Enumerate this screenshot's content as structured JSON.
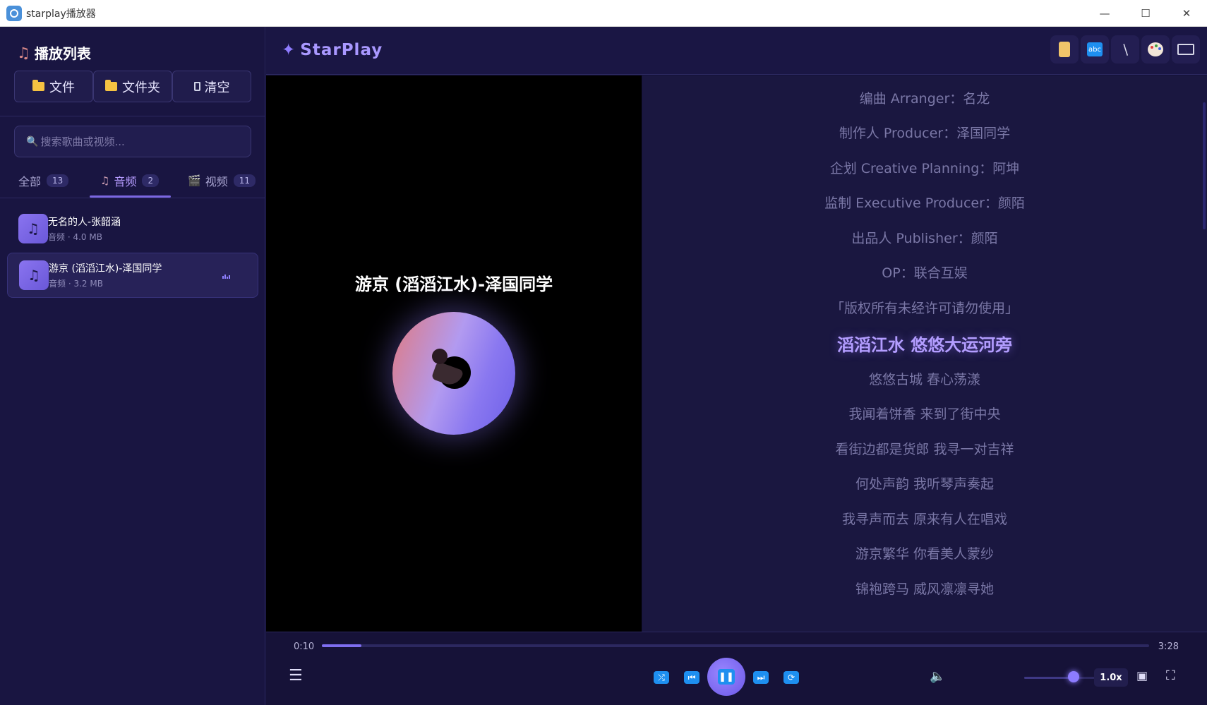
{
  "window": {
    "title": "starplay播放器",
    "minimize": "—",
    "maximize": "☐",
    "close": "✕"
  },
  "sidebar": {
    "heading": "播放列表",
    "buttons": {
      "file": "文件",
      "folder": "文件夹",
      "clear": "清空"
    },
    "search_placeholder": "搜索歌曲或视频...",
    "tabs": [
      {
        "label": "全部",
        "count": "13"
      },
      {
        "label": "音频",
        "count": "2"
      },
      {
        "label": "视频",
        "count": "11"
      }
    ],
    "active_tab": "音频",
    "items": [
      {
        "title": "无名的人-张韶涵",
        "meta": "音频 · 4.0 MB"
      },
      {
        "title": "游京 (滔滔江水)-泽国同学",
        "meta": "音频 · 3.2 MB"
      }
    ]
  },
  "header": {
    "brand": "StarPlay",
    "tools": [
      "scroll-icon",
      "abc-icon",
      "brush-icon",
      "palette-icon",
      "keyboard-icon"
    ]
  },
  "player": {
    "now_title": "游京 (滔滔江水)-泽国同学",
    "current_time": "0:10",
    "duration": "3:28",
    "progress": 0.048,
    "volume": 0.7,
    "speed": "1.0x"
  },
  "lyrics": {
    "lines": [
      "编曲 Arranger：名龙",
      "制作人 Producer：泽国同学",
      "企划 Creative Planning：阿坤",
      "监制 Executive Producer：颜陌",
      "出品人 Publisher：颜陌",
      "OP：联合互娱",
      "「版权所有未经许可请勿使用」",
      "滔滔江水 悠悠大运河旁",
      "悠悠古城 春心荡漾",
      "我闻着饼香 来到了街中央",
      "看街边都是货郎 我寻一对吉祥",
      "何处声韵 我听琴声奏起",
      "我寻声而去 原来有人在唱戏",
      "游京繁华 你看美人蒙纱",
      "锦袍跨马 威风凛凛寻她"
    ],
    "current_index": 7
  },
  "colors": {
    "accent": "#7f6ef0",
    "background": "#15123a",
    "lyric_current": "#b39dff"
  }
}
